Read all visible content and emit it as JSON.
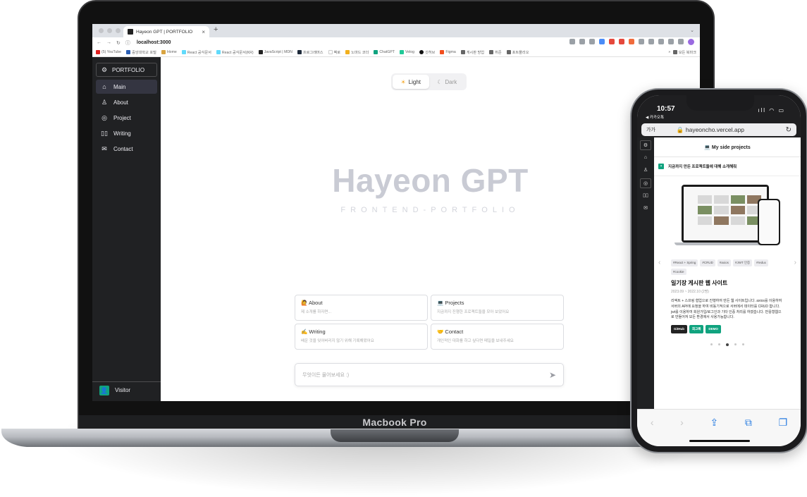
{
  "laptop": {
    "label": "Macbook Pro",
    "browser": {
      "tab_title": "Hayeon GPT | PORTFOLIO",
      "new_tab": "+",
      "url": "localhost:3000",
      "bookmarks": [
        "(5) YouTube",
        "중앙대학교 포털",
        "Home",
        "React 공식문서",
        "React 공식문서(KR)",
        "JavaScript | MDN",
        "프로그래머스",
        "벡로",
        "노마드 코더",
        "ChatGPT",
        "Velog",
        "깃허브",
        "Figma",
        "게시판 방업",
        "취준",
        "포트폴리오",
        "모든 북마크"
      ]
    },
    "sidebar": {
      "brand": "PORTFOLIO",
      "items": [
        {
          "label": "Main",
          "icon": "home-icon"
        },
        {
          "label": "About",
          "icon": "user-icon"
        },
        {
          "label": "Project",
          "icon": "chat-icon"
        },
        {
          "label": "Writing",
          "icon": "book-icon"
        },
        {
          "label": "Contact",
          "icon": "mail-icon"
        }
      ],
      "visitor": "Visitor"
    },
    "theme": {
      "light": "Light",
      "dark": "Dark"
    },
    "hero": {
      "title": "Hayeon GPT",
      "subtitle": "FRONTEND-PORTFOLIO"
    },
    "cards": [
      {
        "title": "🙋 About",
        "desc": "제 소개를 하자면..."
      },
      {
        "title": "💻 Projects",
        "desc": "지금까지 진행한 프로젝트들을 모아 보았어요"
      },
      {
        "title": "✍️ Writing",
        "desc": "배운 것을 잊어버리지 않기 위해 기록해왔어요"
      },
      {
        "title": "🤝 Contact",
        "desc": "개인적인 대화를 하고 싶다면 메일을 보내주세요"
      }
    ],
    "prompt_placeholder": "무엇이든 물어보세요 :)"
  },
  "phone": {
    "time": "10:57",
    "back_app": "◀ 카카오톡",
    "text_size": "가가",
    "domain": "hayeoncho.vercel.app",
    "header": "💻 My side projects",
    "intro": "지금까지 만든 프로젝트들에 대해 소개해줘",
    "tags": [
      "#React + Spring",
      "#CRUD",
      "#axios",
      "#JWT 인증",
      "#redux",
      "#cookie"
    ],
    "project_title": "일기장 게시판 웹 사이트",
    "project_date": "2023.09 ~ 2022.10 (2명)",
    "project_desc": "리액트 + 스프링 협업으로 진행하여 만든 웹 사이트입니다. axios를 이용하여 서버의 API에 요청을 하여 비동기적으로 서버에서 데이터를 CRUD 합니다. jwt를 이용하여 회원가입/로그인과 기타 인증 처리를 하였습니다. 반응형웹으로 만들어져 모든 환경에서 사용가능합니다.",
    "buttons": [
      "GitHub",
      "회고록",
      "DEMO"
    ]
  }
}
